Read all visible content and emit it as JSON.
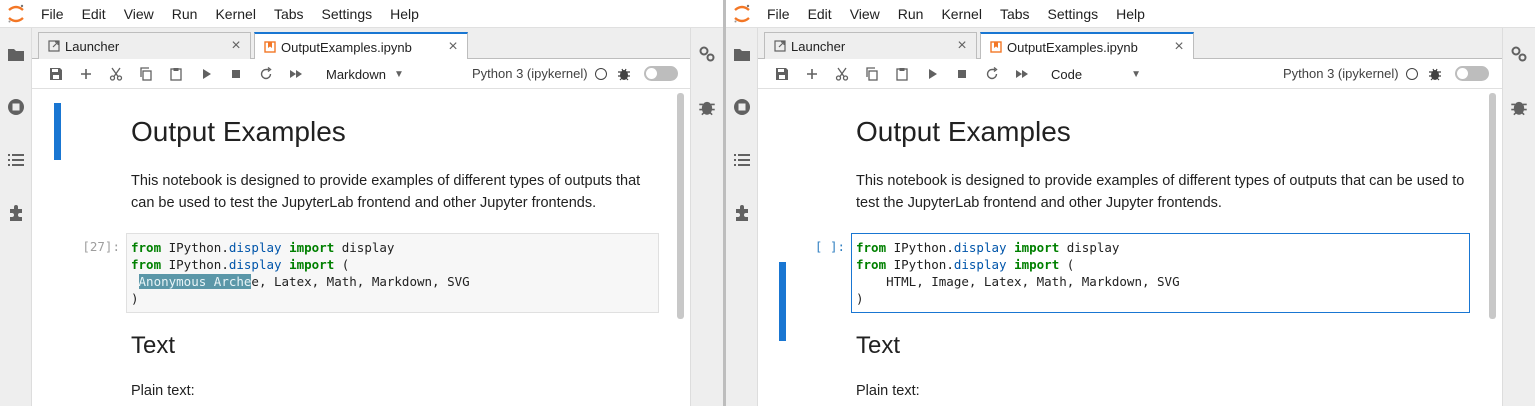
{
  "menubar": {
    "items": [
      "File",
      "Edit",
      "View",
      "Run",
      "Kernel",
      "Tabs",
      "Settings",
      "Help"
    ]
  },
  "left": {
    "tabs": {
      "launcher": "Launcher",
      "notebook": "OutputExamples.ipynb"
    },
    "cell_type": "Markdown",
    "kernel": "Python 3 (ipykernel)",
    "cell_prompt": "[27]:",
    "autocomplete_text": "Anonymous Arche"
  },
  "right": {
    "tabs": {
      "launcher": "Launcher",
      "notebook": "OutputExamples.ipynb"
    },
    "cell_type": "Code",
    "kernel": "Python 3 (ipykernel)",
    "cell_prompt": "[ ]:"
  },
  "notebook": {
    "h1": "Output Examples",
    "intro_left_1": "This notebook is designed to provide examples of different types of outputs that",
    "intro_left_2": "can be used to test the JupyterLab frontend and other Jupyter frontends.",
    "intro_right_1": "This notebook is designed to provide examples of different types of outputs that can be used to",
    "intro_right_2": "test the JupyterLab frontend and other Jupyter frontends.",
    "code": {
      "kw_from": "from",
      "kw_import": "import",
      "ipython": " IPython.",
      "display_mod": "display",
      "import_target": " display",
      "open_paren": " (",
      "line3_tail_left": "e, Latex, Math, Markdown, SVG",
      "line3_right": "    HTML, Image, Latex, Math, Markdown, SVG",
      "close_paren": ")"
    },
    "h2": "Text",
    "plain_text": "Plain text:"
  }
}
